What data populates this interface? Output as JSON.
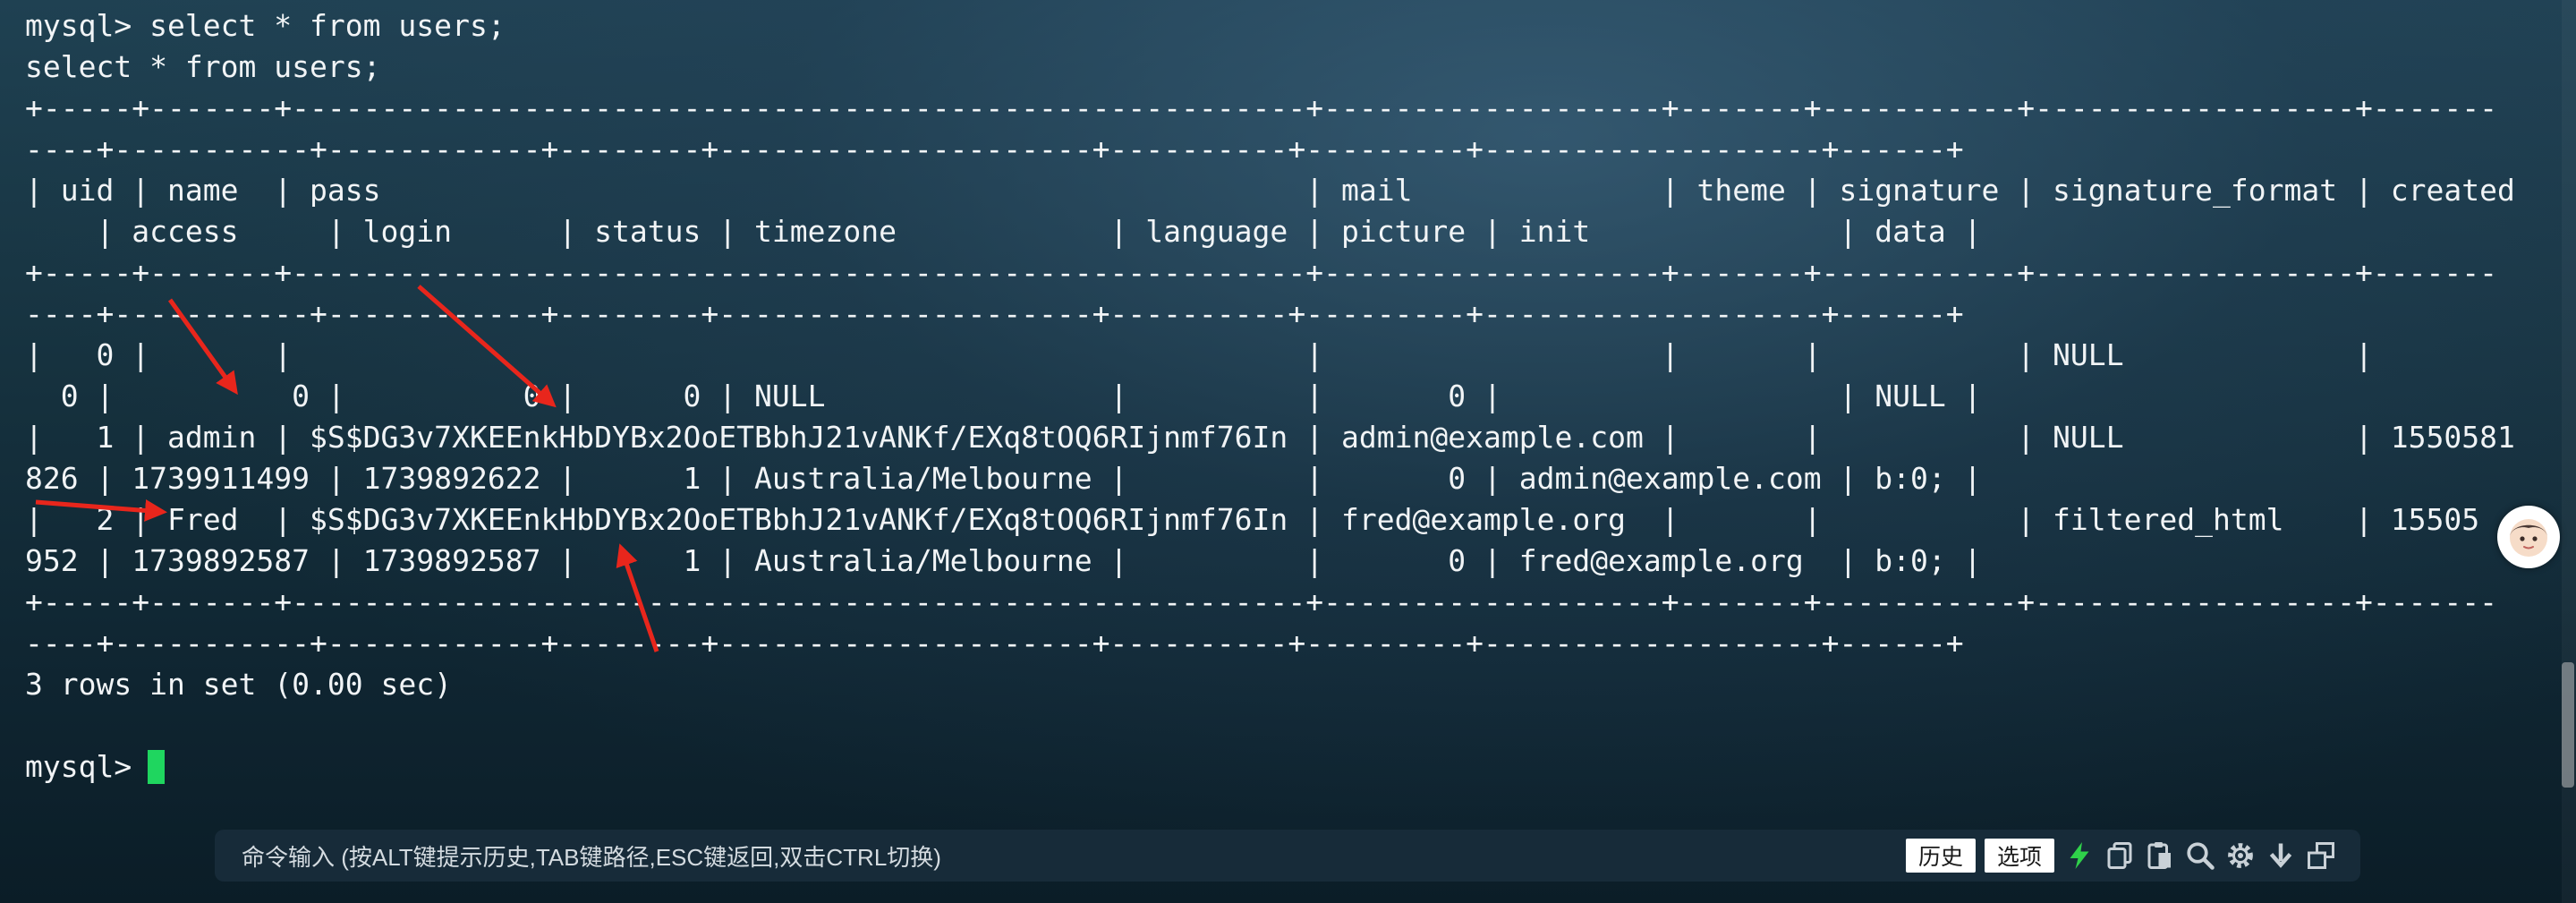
{
  "terminal": {
    "lines": [
      "mysql> select * from users;",
      "select * from users;",
      "+-----+-------+---------------------------------------------------------+-------------------+-------+-----------+------------------+-------",
      "----+-----------+------------+--------+---------------------+----------+---------+-------------------+------+",
      "| uid | name  | pass                                                    | mail              | theme | signature | signature_format | created",
      "    | access     | login      | status | timezone            | language | picture | init              | data |",
      "+-----+-------+---------------------------------------------------------+-------------------+-------+-----------+------------------+-------",
      "----+-----------+------------+--------+---------------------+----------+---------+-------------------+------+",
      "|   0 |       |                                                         |                   |       |           | NULL             |",
      "  0 |          0 |          0 |      0 | NULL                |          |       0 |                   | NULL |",
      "|   1 | admin | $S$DG3v7XKEEnkHbDYBx2OoETBbhJ21vANKf/EXq8tOQ6RIjnmf76In | admin@example.com |       |           | NULL             | 1550581",
      "826 | 1739911499 | 1739892622 |      1 | Australia/Melbourne |          |       0 | admin@example.com | b:0; |",
      "|   2 | Fred  | $S$DG3v7XKEEnkHbDYBx2OoETBbhJ21vANKf/EXq8tOQ6RIjnmf76In | fred@example.org  |       |           | filtered_html    | 15505",
      "952 | 1739892587 | 1739892587 |      1 | Australia/Melbourne |          |       0 | fred@example.org  | b:0; |",
      "+-----+-------+---------------------------------------------------------+-------------------+-------+-----------+------------------+-------",
      "----+-----------+------------+--------+---------------------+----------+---------+-------------------+------+",
      "3 rows in set (0.00 sec)",
      ""
    ],
    "prompt": "mysql>"
  },
  "bottom_bar": {
    "command_label": "命令输入 (按ALT键提示历史,TAB键路径,ESC键返回,双击CTRL切换)",
    "history_button": "历史",
    "options_button": "选项",
    "icons": [
      "lightning-icon",
      "copy-icon",
      "paste-icon",
      "search-icon",
      "gear-icon",
      "download-icon",
      "window-icon"
    ]
  },
  "colors": {
    "cursor": "#1fd65f",
    "arrow": "#e8261c",
    "lightning": "#2fd14a"
  }
}
